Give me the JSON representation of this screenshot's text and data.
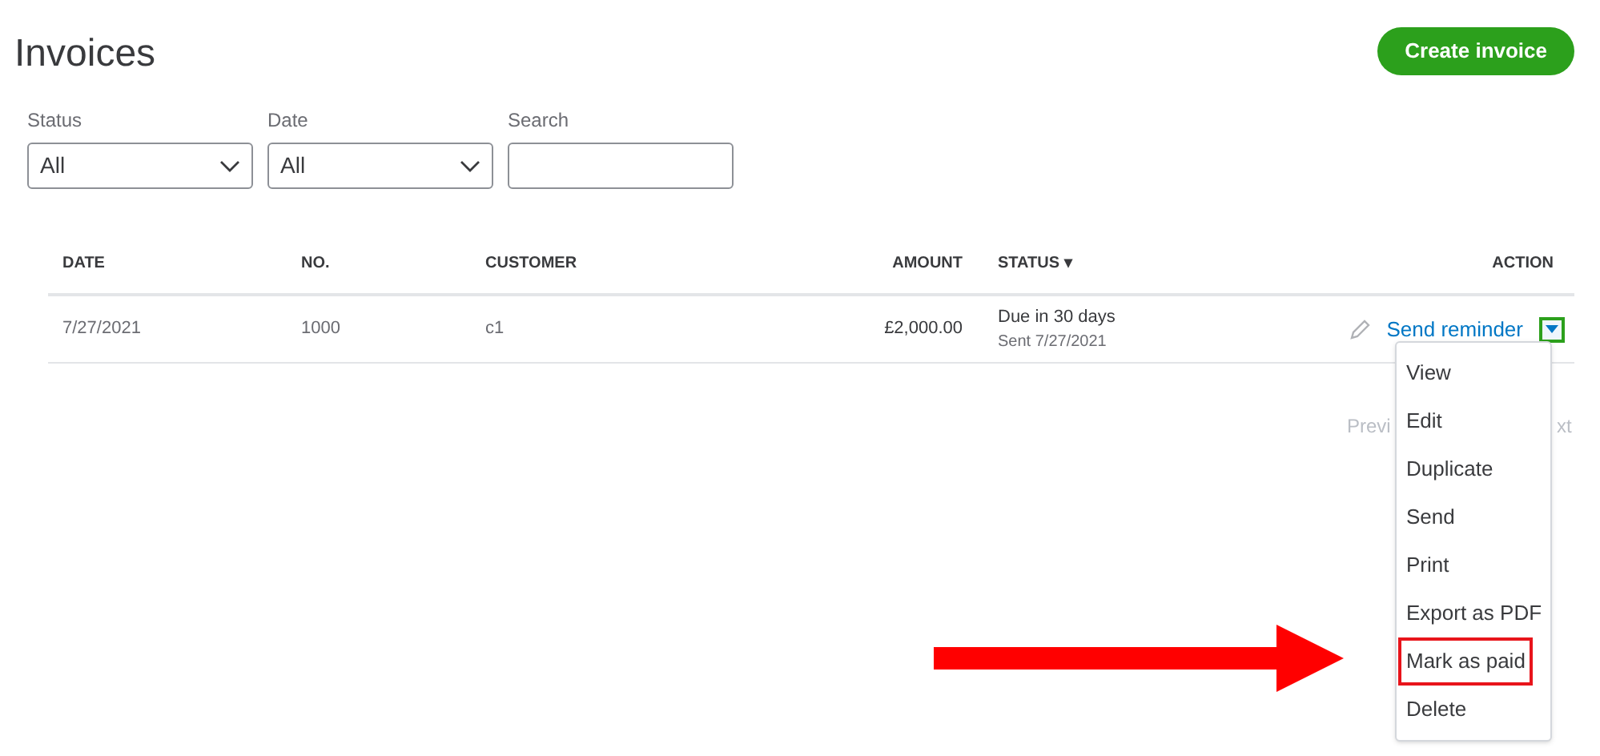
{
  "title": "Invoices",
  "create_button": "Create invoice",
  "filters": [
    {
      "kind": "select",
      "label": "Status",
      "value": "All"
    },
    {
      "kind": "select",
      "label": "Date",
      "value": "All"
    },
    {
      "kind": "text",
      "label": "Search"
    }
  ],
  "table": {
    "columns": [
      {
        "label": "DATE"
      },
      {
        "label": "NO."
      },
      {
        "label": "CUSTOMER"
      },
      {
        "label": "AMOUNT"
      },
      {
        "label": "STATUS ▾"
      },
      {
        "label": "ACTION"
      }
    ],
    "rows": [
      {
        "date": "7/27/2021",
        "no": "1000",
        "customer": "c1",
        "amount": "£2,000.00",
        "status": "Due in 30 days",
        "status_detail": "Sent 7/27/2021",
        "action": "Send reminder",
        "menu_toggle_highlighted": true,
        "menu_open": true
      }
    ]
  },
  "pagination": {
    "previous": "Previ",
    "next": "xt"
  },
  "menu": [
    {
      "label": "View",
      "highlighted": false
    },
    {
      "label": "Edit",
      "highlighted": false
    },
    {
      "label": "Duplicate",
      "highlighted": false
    },
    {
      "label": "Send",
      "highlighted": false
    },
    {
      "label": "Print",
      "highlighted": false
    },
    {
      "label": "Export as PDF",
      "highlighted": false
    },
    {
      "label": "Mark as paid",
      "highlighted": true
    },
    {
      "label": "Delete",
      "highlighted": false
    }
  ]
}
